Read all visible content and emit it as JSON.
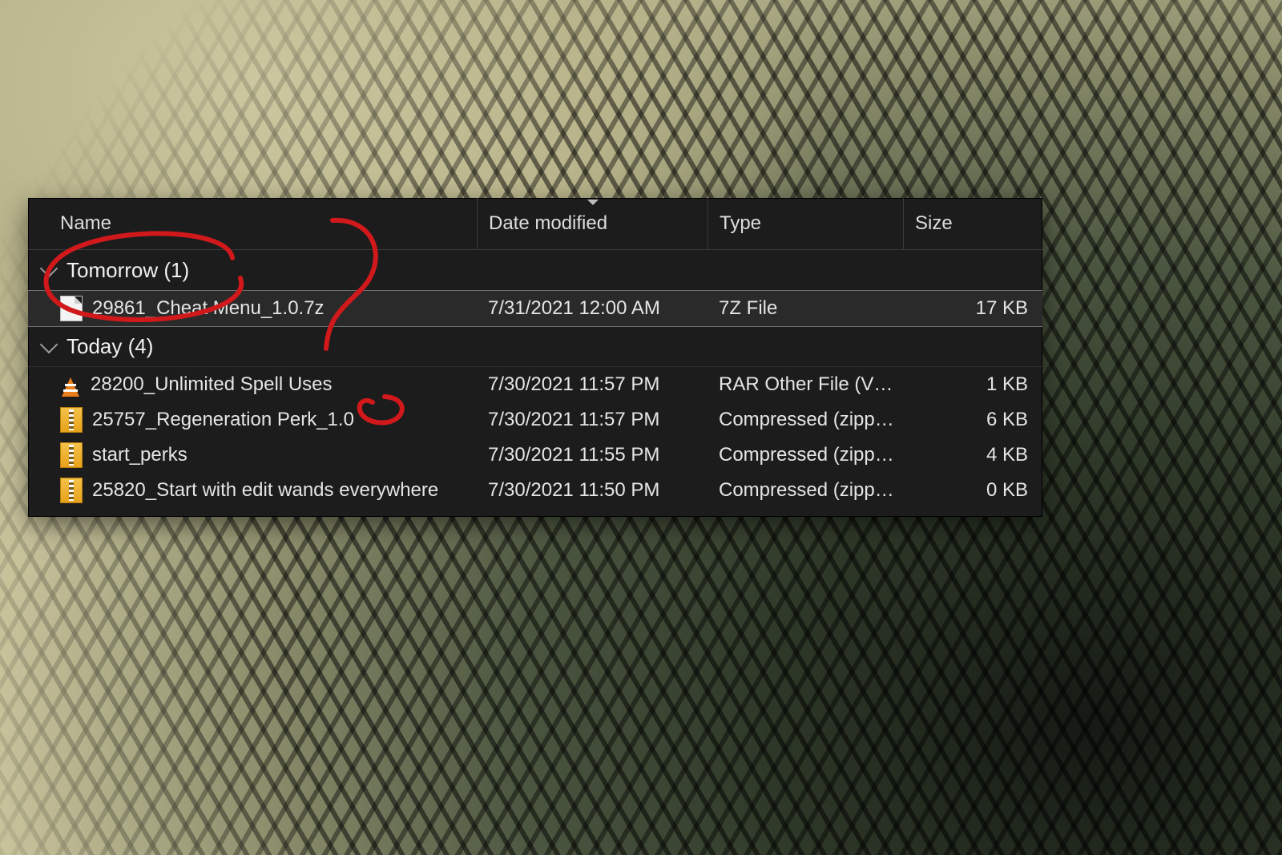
{
  "columns": {
    "name": "Name",
    "date": "Date modified",
    "type": "Type",
    "size": "Size"
  },
  "groups": [
    {
      "label": "Tomorrow (1)",
      "files": [
        {
          "icon": "file",
          "name": "29861_Cheat Menu_1.0.7z",
          "date": "7/31/2021 12:00 AM",
          "type": "7Z File",
          "size": "17 KB",
          "selected": true
        }
      ]
    },
    {
      "label": "Today (4)",
      "files": [
        {
          "icon": "vlc",
          "name": "28200_Unlimited Spell Uses",
          "date": "7/30/2021 11:57 PM",
          "type": "RAR Other File (VL…",
          "size": "1 KB"
        },
        {
          "icon": "zip",
          "name": "25757_Regeneration Perk_1.0",
          "date": "7/30/2021 11:57 PM",
          "type": "Compressed (zipp…",
          "size": "6 KB"
        },
        {
          "icon": "zip",
          "name": "start_perks",
          "date": "7/30/2021 11:55 PM",
          "type": "Compressed (zipp…",
          "size": "4 KB"
        },
        {
          "icon": "zip",
          "name": "25820_Start with edit wands everywhere",
          "date": "7/30/2021 11:50 PM",
          "type": "Compressed (zipp…",
          "size": "0 KB"
        }
      ]
    }
  ],
  "annotation_color": "#d1191c"
}
